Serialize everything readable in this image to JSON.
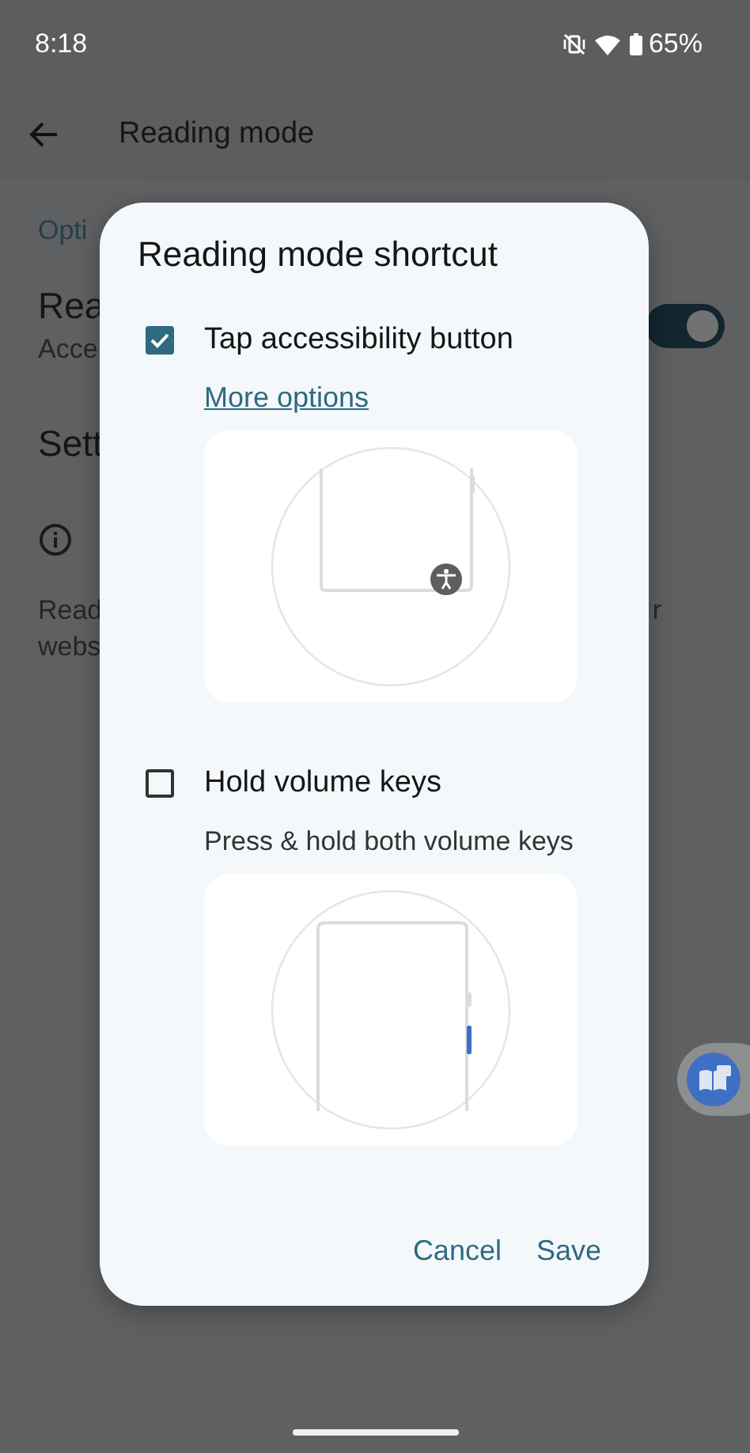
{
  "status_bar": {
    "time": "8:18",
    "battery": "65%"
  },
  "app_bar": {
    "title": "Reading mode"
  },
  "background_fragments": {
    "section": "Opti",
    "setting_title": "Rea",
    "setting_subtitle": "Acce",
    "settings_row": "Sett",
    "description_line_1": "Read",
    "description_line_2": "webs",
    "description_line_end": "r",
    "toggle_on": true
  },
  "dialog": {
    "title": "Reading mode shortcut",
    "options": [
      {
        "label": "Tap accessibility button",
        "checked": true,
        "link": "More options",
        "kind": "button"
      },
      {
        "label": "Hold volume keys",
        "checked": false,
        "description": "Press & hold both volume keys",
        "kind": "volume"
      }
    ],
    "buttons": [
      "Cancel",
      "Save"
    ]
  }
}
